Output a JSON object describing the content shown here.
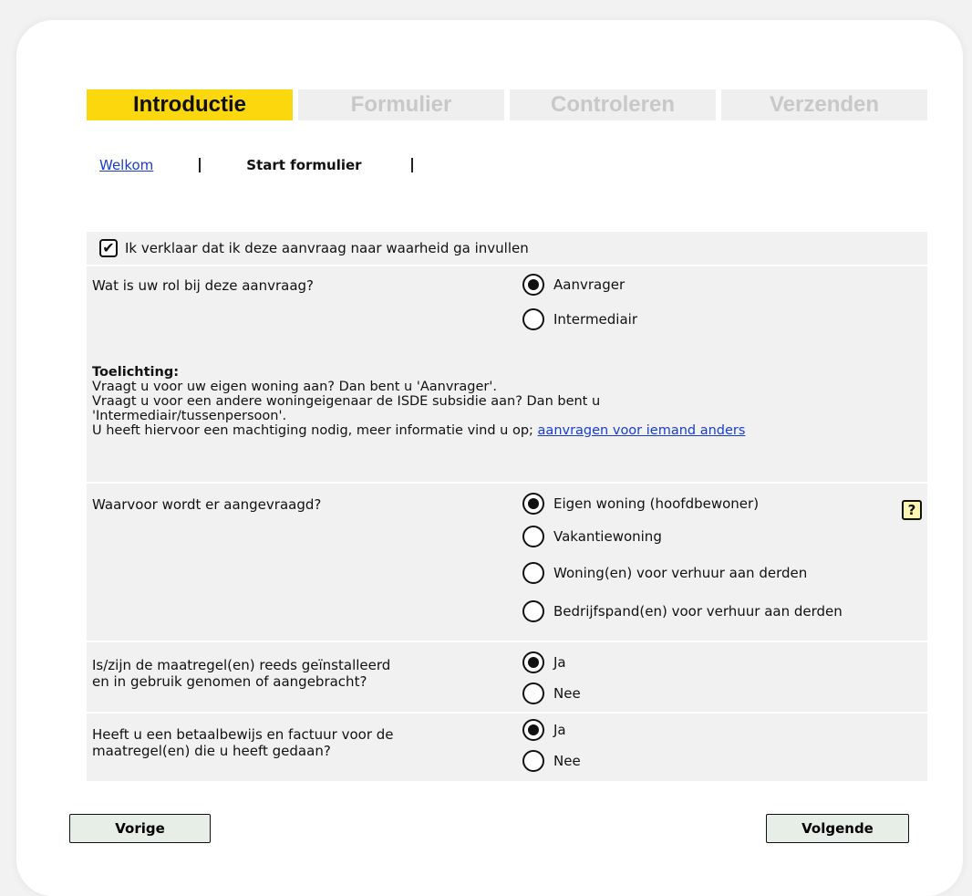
{
  "steps": [
    {
      "label": "Introductie",
      "active": true
    },
    {
      "label": "Formulier",
      "active": false
    },
    {
      "label": "Controleren",
      "active": false
    },
    {
      "label": "Verzenden",
      "active": false
    }
  ],
  "subnav": {
    "welcome_link": "Welkom",
    "current": "Start formulier"
  },
  "declaration": {
    "checked": true,
    "label": "Ik verklaar dat ik deze aanvraag naar waarheid ga invullen"
  },
  "role": {
    "question": "Wat is uw rol bij deze aanvraag?",
    "options": [
      {
        "label": "Aanvrager",
        "selected": true
      },
      {
        "label": "Intermediair",
        "selected": false
      }
    ],
    "explain": {
      "heading": "Toelichting:",
      "line1": "Vraagt u voor uw eigen woning aan? Dan bent u 'Aanvrager'.",
      "line2": "Vraagt u voor een andere woningeigenaar de ISDE subsidie aan? Dan bent u",
      "line3": "'Intermediair/tussenpersoon'.",
      "line4": "U heeft hiervoor een machtiging nodig, meer informatie vind u op;",
      "link": "aanvragen voor iemand anders"
    }
  },
  "purpose": {
    "question": "Waarvoor wordt er aangevraagd?",
    "help": "?",
    "options": [
      {
        "label": "Eigen woning (hoofdbewoner)",
        "selected": true
      },
      {
        "label": "Vakantiewoning",
        "selected": false
      },
      {
        "label": "Woning(en) voor verhuur aan derden",
        "selected": false
      },
      {
        "label": "Bedrijfspand(en) voor verhuur aan derden",
        "selected": false
      }
    ]
  },
  "installed": {
    "question_line1": "Is/zijn de maatregel(en) reeds geïnstalleerd",
    "question_line2": "en in gebruik genomen of aangebracht?",
    "options": [
      {
        "label": "Ja",
        "selected": true
      },
      {
        "label": "Nee",
        "selected": false
      }
    ]
  },
  "invoice": {
    "question_line1": "Heeft u een betaalbewijs en factuur voor de",
    "question_line2": "maatregel(en) die u heeft gedaan?",
    "options": [
      {
        "label": "Ja",
        "selected": true
      },
      {
        "label": "Nee",
        "selected": false
      }
    ]
  },
  "buttons": {
    "prev": "Vorige",
    "next": "Volgende"
  },
  "colors": {
    "active_step": "#fbd80e",
    "inactive_step": "#efefef",
    "link": "#1a3ccf",
    "row_bg": "#f1f1f1",
    "button_bg": "#e7eee7"
  }
}
